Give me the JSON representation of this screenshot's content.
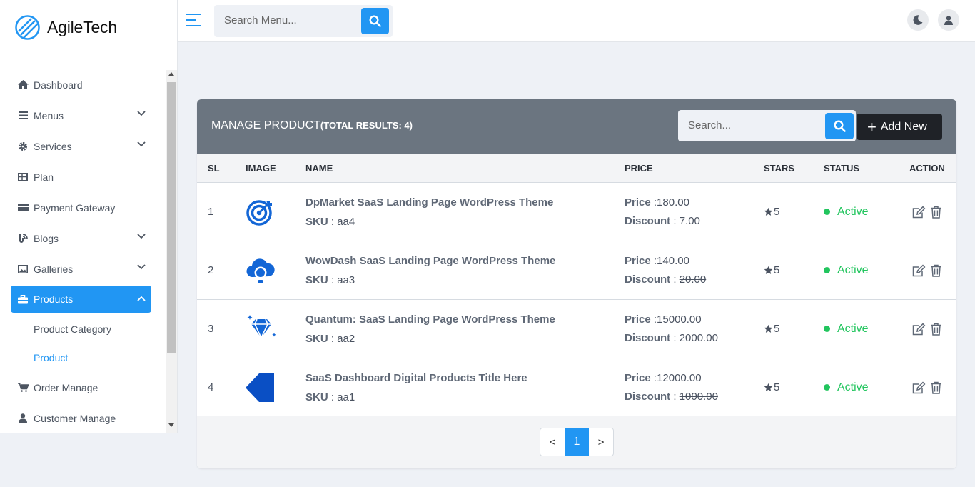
{
  "brand": {
    "name": "AgileTech"
  },
  "sidebar": {
    "items": [
      {
        "label": "Dashboard",
        "icon": "home-icon"
      },
      {
        "label": "Menus",
        "icon": "list-icon",
        "expandable": true
      },
      {
        "label": "Services",
        "icon": "gear-icon",
        "expandable": true
      },
      {
        "label": "Plan",
        "icon": "table-icon"
      },
      {
        "label": "Payment Gateway",
        "icon": "credit-card-icon"
      },
      {
        "label": "Blogs",
        "icon": "blog-icon",
        "expandable": true
      },
      {
        "label": "Galleries",
        "icon": "image-icon",
        "expandable": true
      },
      {
        "label": "Products",
        "icon": "briefcase-icon",
        "expanded": true,
        "active": true
      },
      {
        "label": "Product Category"
      },
      {
        "label": "Product",
        "current": true
      },
      {
        "label": "Order Manage",
        "icon": "cart-icon"
      },
      {
        "label": "Customer Manage",
        "icon": "user-icon"
      }
    ]
  },
  "topbar": {
    "search_placeholder": "Search Menu..."
  },
  "card": {
    "title": "MANAGE PRODUCT",
    "subtitle": "(TOTAL RESULTS: 4)",
    "search_placeholder": "Search...",
    "add_label": "Add New"
  },
  "table": {
    "headers": [
      "SL",
      "IMAGE",
      "NAME",
      "PRICE",
      "STARS",
      "STATUS",
      "ACTION"
    ],
    "price_label": "Price",
    "discount_label": "Discount",
    "sku_label": "SKU",
    "rows": [
      {
        "sl": "1",
        "image": "target-logo-icon",
        "name": "DpMarket SaaS Landing Page WordPress Theme",
        "sku": "aa4",
        "price": "180.00",
        "discount": "7.00",
        "stars": "5",
        "status": "Active"
      },
      {
        "sl": "2",
        "image": "cloud-bulb-logo-icon",
        "name": "WowDash SaaS Landing Page WordPress Theme",
        "sku": "aa3",
        "price": "140.00",
        "discount": "20.00",
        "stars": "5",
        "status": "Active"
      },
      {
        "sl": "3",
        "image": "diamond-logo-icon",
        "name": "Quantum: SaaS Landing Page WordPress Theme",
        "sku": "aa2",
        "price": "15000.00",
        "discount": "2000.00",
        "stars": "5",
        "status": "Active"
      },
      {
        "sl": "4",
        "image": "tag-logo-icon",
        "name": "SaaS Dashboard Digital Products Title Here",
        "sku": "aa1",
        "price": "12000.00",
        "discount": "1000.00",
        "stars": "5",
        "status": "Active"
      }
    ]
  },
  "pagination": {
    "prev": "<",
    "current": "1",
    "next": ">"
  },
  "colors": {
    "accent": "#2196f3",
    "header": "#6b7580",
    "active": "#22c55e",
    "dark_button": "#1f2227"
  }
}
